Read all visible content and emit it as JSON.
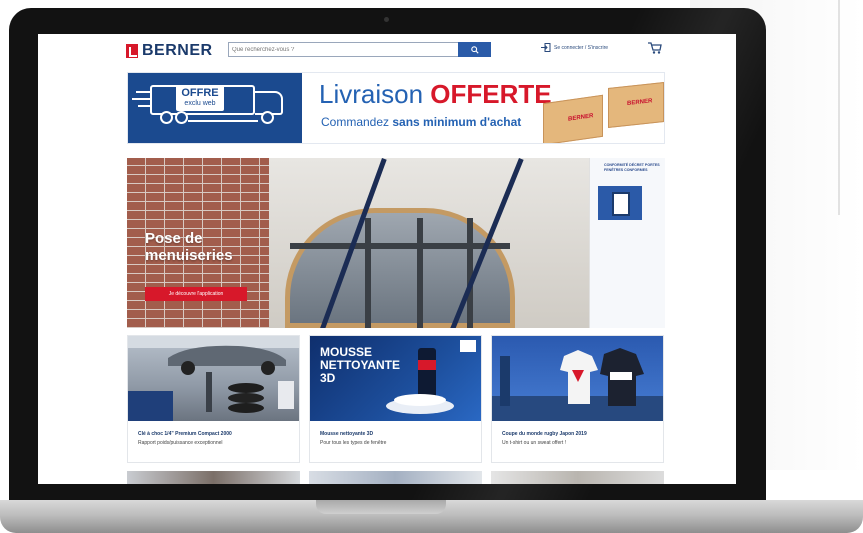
{
  "brand": {
    "name": "BERNER",
    "color": "#1b3a6b",
    "accent": "#d7182a"
  },
  "header": {
    "search_placeholder": "Que recherchez-vous ?",
    "search_icon": "search-icon",
    "login_label": "Se connecter / S'inscrire",
    "login_icon": "login-icon",
    "cart_icon": "cart-icon"
  },
  "promo": {
    "badge_line1": "OFFRE",
    "badge_line2": "exclu web",
    "title_part1": "Livraison ",
    "title_part2": "OFFERTE",
    "subtitle_part1": "Commandez ",
    "subtitle_part2": "sans minimum d'achat",
    "box_logo": "BERNER"
  },
  "hero": {
    "title_line1": "Pose de",
    "title_line2": "menuiseries",
    "button_label": "Je découvre l'application",
    "side_text": "CONFORMITÉ DÉCRET PORTES FENÊTRES CONFORMES"
  },
  "cards": [
    {
      "title": "Clé à choc 1/4\" Premium Compact 2000",
      "subtitle": "Rapport poids/puissance exceptionnel"
    },
    {
      "title": "Mousse nettoyante 3D",
      "subtitle": "Pour tous les types de fenêtre",
      "image_text_line1": "MOUSSE",
      "image_text_line2": "NETTOYANTE",
      "image_text_line3": "3D"
    },
    {
      "title": "Coupe du monde rugby Japon 2019",
      "subtitle": "Un t-shirt ou un sweat offert !"
    }
  ]
}
